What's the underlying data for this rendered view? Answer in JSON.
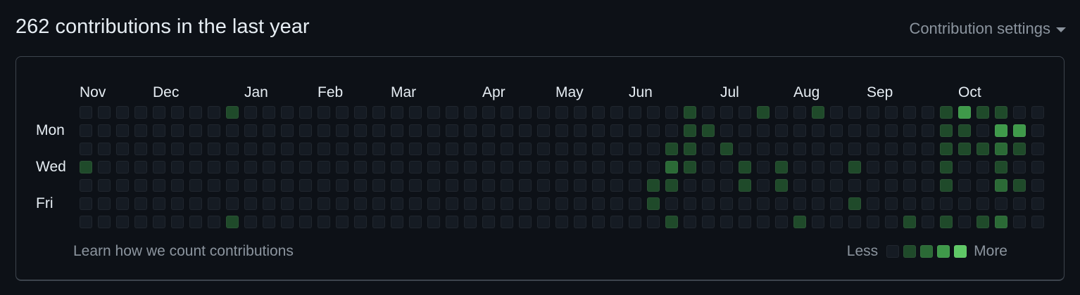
{
  "header": {
    "title": "262 contributions in the last year",
    "settings_label": "Contribution settings",
    "settings_icon": "caret-down-icon"
  },
  "calendar": {
    "months": [
      "Nov",
      "Dec",
      "Jan",
      "Feb",
      "Mar",
      "Apr",
      "May",
      "Jun",
      "Jul",
      "Aug",
      "Sep",
      "Oct"
    ],
    "month_start_week": [
      0,
      4,
      9,
      13,
      17,
      22,
      26,
      30,
      35,
      39,
      43,
      48
    ],
    "day_labels": [
      {
        "label": "Mon",
        "row": 1
      },
      {
        "label": "Wed",
        "row": 3
      },
      {
        "label": "Fri",
        "row": 5
      }
    ],
    "weeks": 53,
    "level_colors": [
      "#161b22",
      "#0e4429",
      "#006d32",
      "#26a641",
      "#39d353"
    ],
    "display_colors": [
      "#151b23",
      "#1f4a2a",
      "#2b6a36",
      "#3f9a4a",
      "#5fc866"
    ],
    "active_days": [
      [
        0,
        3,
        1
      ],
      [
        8,
        0,
        1
      ],
      [
        8,
        6,
        1
      ],
      [
        32,
        2,
        1
      ],
      [
        32,
        3,
        2
      ],
      [
        32,
        6,
        1
      ],
      [
        33,
        0,
        1
      ],
      [
        33,
        1,
        1
      ],
      [
        33,
        2,
        1
      ],
      [
        33,
        3,
        1
      ],
      [
        31,
        4,
        1
      ],
      [
        31,
        5,
        1
      ],
      [
        32,
        4,
        1
      ],
      [
        34,
        1,
        1
      ],
      [
        35,
        2,
        1
      ],
      [
        36,
        3,
        1
      ],
      [
        36,
        4,
        1
      ],
      [
        37,
        0,
        1
      ],
      [
        39,
        6,
        1
      ],
      [
        38,
        3,
        1
      ],
      [
        38,
        4,
        1
      ],
      [
        40,
        0,
        1
      ],
      [
        42,
        3,
        1
      ],
      [
        42,
        5,
        1
      ],
      [
        45,
        6,
        1
      ],
      [
        47,
        0,
        1
      ],
      [
        47,
        1,
        1
      ],
      [
        47,
        2,
        1
      ],
      [
        47,
        3,
        1
      ],
      [
        47,
        4,
        1
      ],
      [
        47,
        6,
        1
      ],
      [
        48,
        0,
        3
      ],
      [
        48,
        1,
        1
      ],
      [
        48,
        2,
        1
      ],
      [
        49,
        0,
        1
      ],
      [
        49,
        2,
        1
      ],
      [
        49,
        6,
        1
      ],
      [
        50,
        0,
        1
      ],
      [
        50,
        1,
        3
      ],
      [
        50,
        2,
        2
      ],
      [
        50,
        3,
        1
      ],
      [
        50,
        4,
        2
      ],
      [
        50,
        6,
        2
      ],
      [
        51,
        1,
        3
      ],
      [
        51,
        2,
        1
      ],
      [
        51,
        4,
        1
      ]
    ]
  },
  "footer": {
    "learn_link": "Learn how we count contributions",
    "legend_less": "Less",
    "legend_more": "More"
  }
}
